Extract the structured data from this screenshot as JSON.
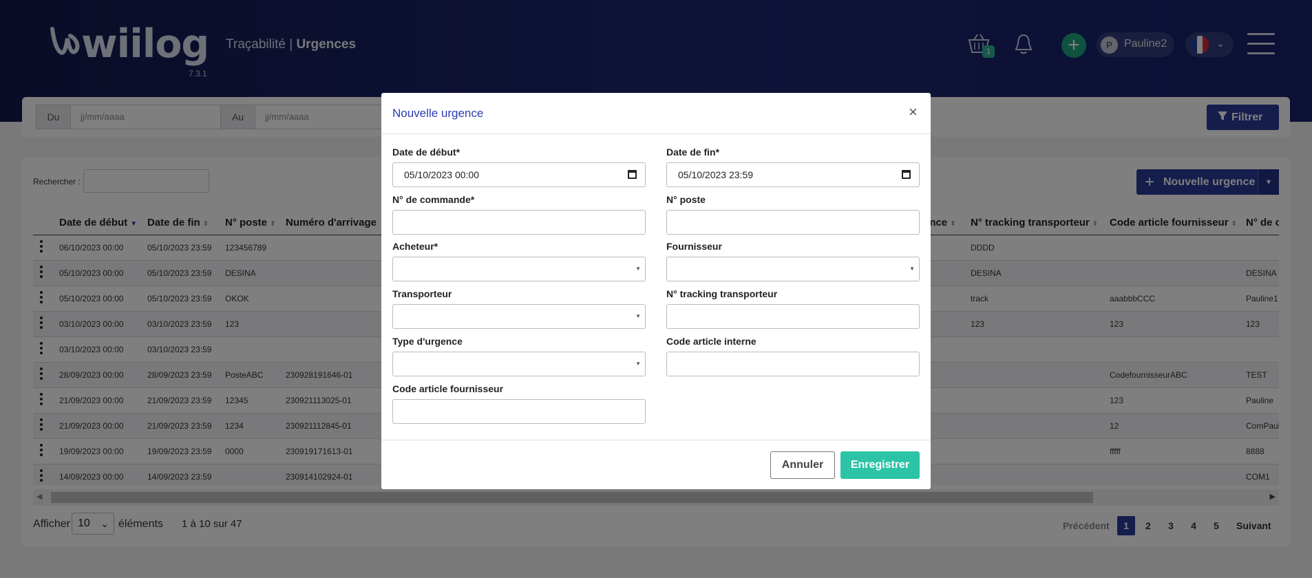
{
  "header": {
    "logo": "wiilog",
    "version": "7.3.1",
    "title_prefix": "Traçabilité | ",
    "title_bold": "Urgences",
    "basket_count": "1",
    "add_symbol": "+",
    "user_initial": "P",
    "user_name": "Pauline2",
    "language_flag": "fr-flag-icon",
    "chevron": "⌄"
  },
  "filters": {
    "from_label": "Du",
    "from_placeholder": "jj/mm/aaaa",
    "to_label": "Au",
    "to_placeholder": "jj/mm/aaaa",
    "filter_button": "Filtrer"
  },
  "table": {
    "search_label": "Rechercher :",
    "new_button": "Nouvelle urgence",
    "columns": [
      "Date de début",
      "Date de fin",
      "N° poste",
      "Numéro d'arrivage",
      "ence",
      "N° tracking transporteur",
      "Code article fournisseur",
      "N° de c"
    ],
    "rows": [
      {
        "start": "06/10/2023 00:00",
        "end": "05/10/2023 23:59",
        "post": "123456789",
        "arrival": "",
        "tracking": "DDDD",
        "supplier_code": "",
        "order": ""
      },
      {
        "start": "05/10/2023 00:00",
        "end": "05/10/2023 23:59",
        "post": "DESINA",
        "arrival": "",
        "tracking": "DESINA",
        "supplier_code": "",
        "order": "DESINA"
      },
      {
        "start": "05/10/2023 00:00",
        "end": "05/10/2023 23:59",
        "post": "OKOK",
        "arrival": "",
        "tracking": "track",
        "supplier_code": "aaabbbCCC",
        "order": "Pauline1"
      },
      {
        "start": "03/10/2023 00:00",
        "end": "03/10/2023 23:59",
        "post": "123",
        "arrival": "",
        "tracking": "123",
        "supplier_code": "123",
        "order": "123"
      },
      {
        "start": "03/10/2023 00:00",
        "end": "03/10/2023 23:59",
        "post": "",
        "arrival": "",
        "tracking": "",
        "supplier_code": "",
        "order": ""
      },
      {
        "start": "28/09/2023 00:00",
        "end": "28/09/2023 23:59",
        "post": "PosteABC",
        "arrival": "230928191646-01",
        "tracking": "",
        "supplier_code": "CodefournisseurABC",
        "order": "TEST"
      },
      {
        "start": "21/09/2023 00:00",
        "end": "21/09/2023 23:59",
        "post": "12345",
        "arrival": "230921113025-01",
        "tracking": "",
        "supplier_code": "123",
        "order": "Pauline"
      },
      {
        "start": "21/09/2023 00:00",
        "end": "21/09/2023 23:59",
        "post": "1234",
        "arrival": "230921112845-01",
        "tracking": "",
        "supplier_code": "12",
        "order": "ComPaul"
      },
      {
        "start": "19/09/2023 00:00",
        "end": "19/09/2023 23:59",
        "post": "0000",
        "arrival": "230919171613-01",
        "tracking": "",
        "supplier_code": "fffff",
        "order": "8888"
      },
      {
        "start": "14/09/2023 00:00",
        "end": "14/09/2023 23:59",
        "post": "",
        "arrival": "230914102924-01",
        "tracking": "",
        "supplier_code": "",
        "order": "COM1"
      }
    ],
    "show_label": "Afficher",
    "page_size": "10",
    "elements_label": "éléments",
    "range_info": "1 à 10 sur 47",
    "pagination": {
      "prev": "Précédent",
      "pages": [
        "1",
        "2",
        "3",
        "4",
        "5"
      ],
      "next": "Suivant",
      "current": "1"
    }
  },
  "modal": {
    "title": "Nouvelle urgence",
    "close": "×",
    "fields": {
      "start_date_label": "Date de début*",
      "start_date_value": "05/10/2023 00:00",
      "end_date_label": "Date de fin*",
      "end_date_value": "05/10/2023 23:59",
      "order_label": "N° de commande*",
      "order_value": "",
      "post_label": "N° poste",
      "post_value": "",
      "buyer_label": "Acheteur*",
      "buyer_value": "",
      "supplier_label": "Fournisseur",
      "supplier_value": "",
      "carrier_label": "Transporteur",
      "carrier_value": "",
      "tracking_label": "N° tracking transporteur",
      "tracking_value": "",
      "type_label": "Type d'urgence",
      "type_value": "",
      "internal_code_label": "Code article interne",
      "internal_code_value": "",
      "supplier_code_label": "Code article fournisseur",
      "supplier_code_value": ""
    },
    "cancel_button": "Annuler",
    "save_button": "Enregistrer"
  },
  "colors": {
    "primary": "#2a3b9b",
    "accent": "#2bc4a6",
    "header": "#1d2670",
    "link": "#2a3bb5"
  }
}
